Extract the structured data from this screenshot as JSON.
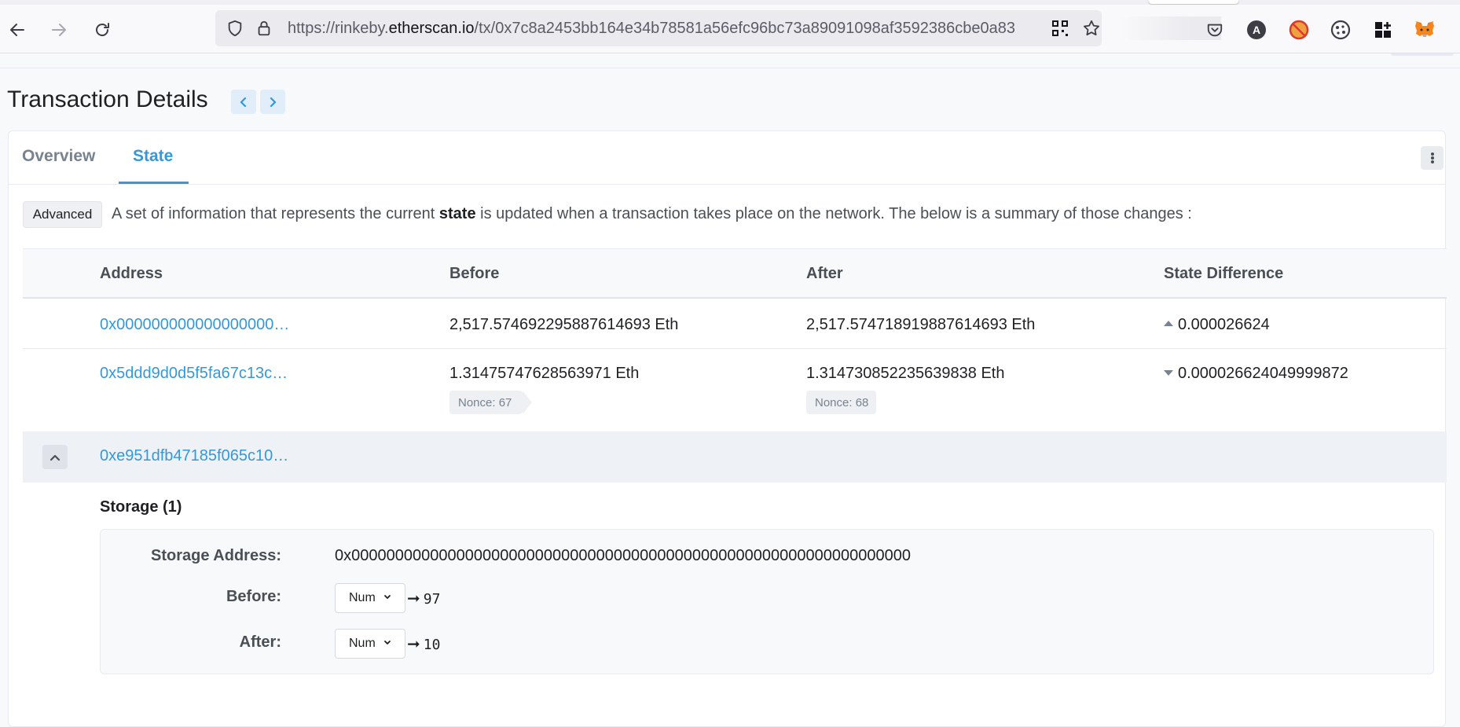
{
  "browser": {
    "url_prefix": "https://rinkeby.",
    "url_domain": "etherscan.io",
    "url_path": "/tx/0x7c8a2453bb164e34b78581a56efc96bc73a89091098af3592386cbe0a83",
    "icons": [
      "back-icon",
      "forward-icon",
      "reload-icon",
      "shield-icon",
      "lock-icon",
      "qr-code-icon",
      "star-icon",
      "pocket-icon",
      "account-icon",
      "blocked-extension-icon",
      "cookie-icon",
      "extensions-icon",
      "metamask-icon"
    ]
  },
  "page": {
    "title": "Transaction Details"
  },
  "tabs": [
    {
      "label": "Overview",
      "active": false
    },
    {
      "label": "State",
      "active": true
    }
  ],
  "state": {
    "advanced_label": "Advanced",
    "description_pre": "A set of information that represents the current ",
    "description_bold": "state",
    "description_post": " is updated when a transaction takes place on the network. The below is a summary of those changes :",
    "columns": [
      "Address",
      "Before",
      "After",
      "State Difference"
    ],
    "rows": [
      {
        "address": "0x000000000000000000…",
        "before": "2,517.574692295887614693 Eth",
        "after": "2,517.574718919887614693 Eth",
        "difference": "0.000026624",
        "direction": "up"
      },
      {
        "address": "0x5ddd9d0d5f5fa67c13c…",
        "before": "1.31475747628563971 Eth",
        "after": "1.314730852235639838 Eth",
        "difference": "0.000026624049999872",
        "direction": "down",
        "nonce_before": "Nonce: 67",
        "nonce_after": "Nonce: 68"
      },
      {
        "address": "0xe951dfb47185f065c10…",
        "expanded": true
      }
    ],
    "storage": {
      "title": "Storage (1)",
      "address_label": "Storage Address:",
      "address_value": "0x0000000000000000000000000000000000000000000000000000000000000000",
      "before_label": "Before:",
      "before_format": "Num",
      "before_value": "97",
      "after_label": "After:",
      "after_format": "Num",
      "after_value": "10"
    }
  },
  "colors": {
    "link": "#3498db",
    "text": "#1e2022",
    "muted": "#77838f"
  }
}
